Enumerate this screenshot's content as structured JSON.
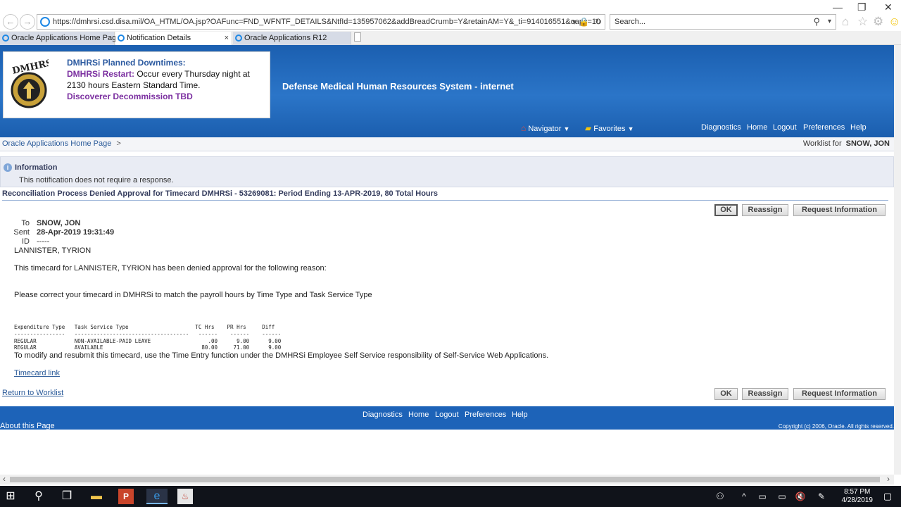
{
  "browser": {
    "url": "https://dmhrsi.csd.disa.mil/OA_HTML/OA.jsp?OAFunc=FND_WFNTF_DETAILS&NtfId=135957062&addBreadCrumb=Y&retainAM=Y&_ti=914016551&oapc=10",
    "search_placeholder": "Search...",
    "tabs": [
      {
        "label": "Oracle Applications Home Page"
      },
      {
        "label": "Notification Details",
        "close": "×"
      },
      {
        "label": "Oracle Applications R12"
      }
    ]
  },
  "banner": {
    "line1": "DMHRSi Planned Downtimes:",
    "line2_label": "DMHRSi Restart:",
    "line2_text": " Occur every Thursday night at",
    "line3": "2130 hours Eastern Standard Time.",
    "line4": "Discoverer Decommission TBD",
    "system_caption": "Defense Medical Human Resources System - internet",
    "colors": {
      "purple": "#7b2fa0",
      "blue_label": "#2c5aa0",
      "header_blue": "#1d63b8"
    }
  },
  "global_links": {
    "navigator": "Navigator",
    "favorites": "Favorites",
    "diagnostics": "Diagnostics",
    "home": "Home",
    "logout": "Logout",
    "preferences": "Preferences",
    "help": "Help"
  },
  "breadcrumb": {
    "home": "Oracle Applications Home Page",
    "separator": ">",
    "worklist_label": "Worklist for",
    "worklist_user": "SNOW, JON"
  },
  "info": {
    "title": "Information",
    "message": "This notification does not require a response."
  },
  "notification": {
    "subject": "Reconciliation Process Denied Approval for Timecard DMHRSi - 53269081: Period Ending 13-APR-2019, 80 Total Hours",
    "buttons": {
      "ok": "OK",
      "reassign": "Reassign",
      "request_info": "Request Information"
    },
    "to_label": "To",
    "to_value": "SNOW, JON",
    "sent_label": "Sent",
    "sent_value": "28-Apr-2019 19:31:49",
    "id_label": "ID",
    "id_value": "-----",
    "employee": "LANNISTER, TYRION",
    "body1": "This timecard for LANNISTER, TYRION has been denied approval for the following reason:",
    "body2": "Please correct your timecard in DMHRSi to match the payroll hours by Time Type and Task Service Type",
    "table_header": "Expenditure Type   Task Service Type                     TC Hrs    PR Hrs     Diff",
    "table_rule": "----------------   ------------------------------------   ------    ------    ------",
    "table_row1": "REGULAR            NON-AVAILABLE-PAID LEAVE                  .00      9.00      9.00",
    "table_row2": "REGULAR            AVAILABLE                               80.00     71.00      9.00",
    "body3": "To modify and resubmit this timecard, use the Time Entry function under the DMHRSi Employee Self Service responsibility of Self-Service Web Applications.",
    "timecard_link": "Timecard link",
    "return_link": "Return to Worklist"
  },
  "footer": {
    "diagnostics": "Diagnostics",
    "home": "Home",
    "logout": "Logout",
    "preferences": "Preferences",
    "help": "Help",
    "about": "About this Page",
    "copyright": "Copyright (c) 2006, Oracle. All rights reserved."
  },
  "taskbar": {
    "time": "8:57 PM",
    "date": "4/28/2019"
  }
}
